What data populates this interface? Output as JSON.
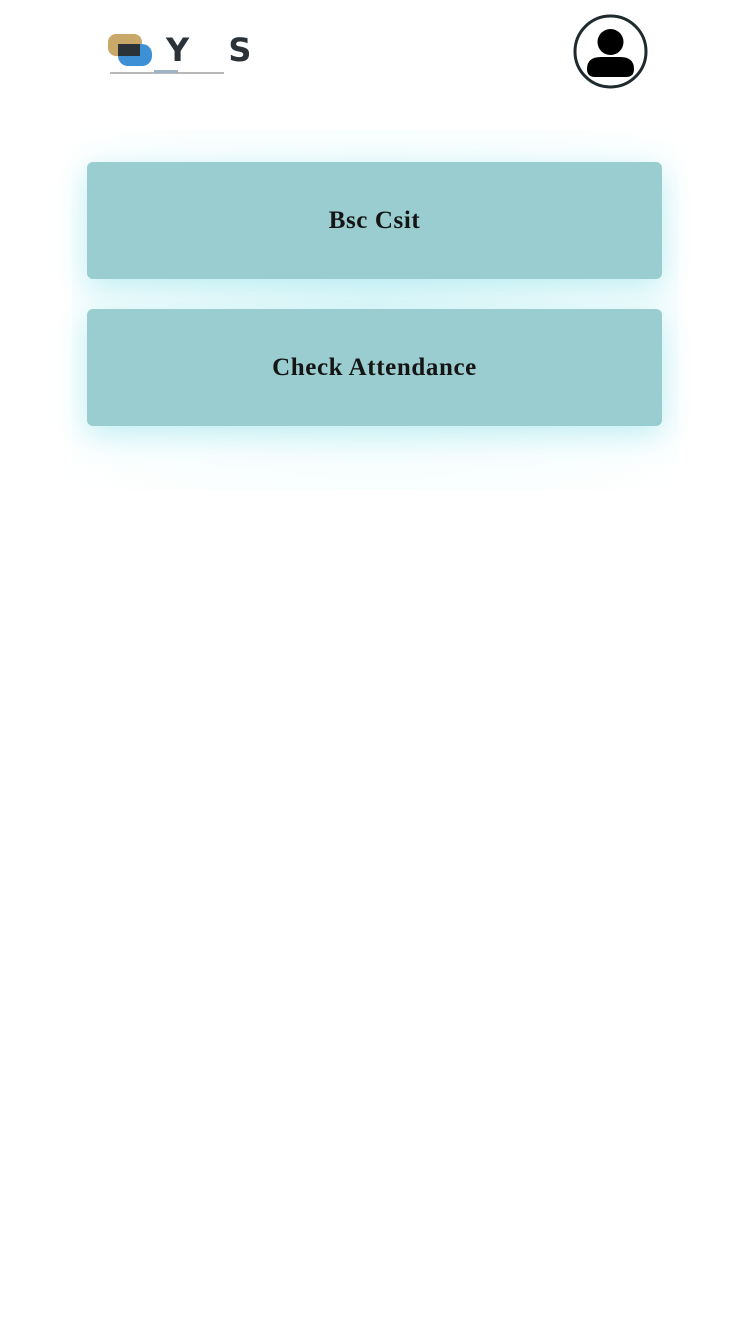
{
  "header": {
    "logo_text": "Y S",
    "logo_icon": "logo-icon",
    "profile_icon": "user-avatar-icon"
  },
  "menu": {
    "items": [
      {
        "label": "Bsc Csit"
      },
      {
        "label": "Check Attendance"
      }
    ]
  },
  "colors": {
    "button_background": "#99cdcf",
    "button_glow": "#78dce6",
    "text": "#151515",
    "logo_gold": "#c9a86a",
    "logo_blue": "#3d8fd6",
    "logo_dark": "#2b3238"
  }
}
